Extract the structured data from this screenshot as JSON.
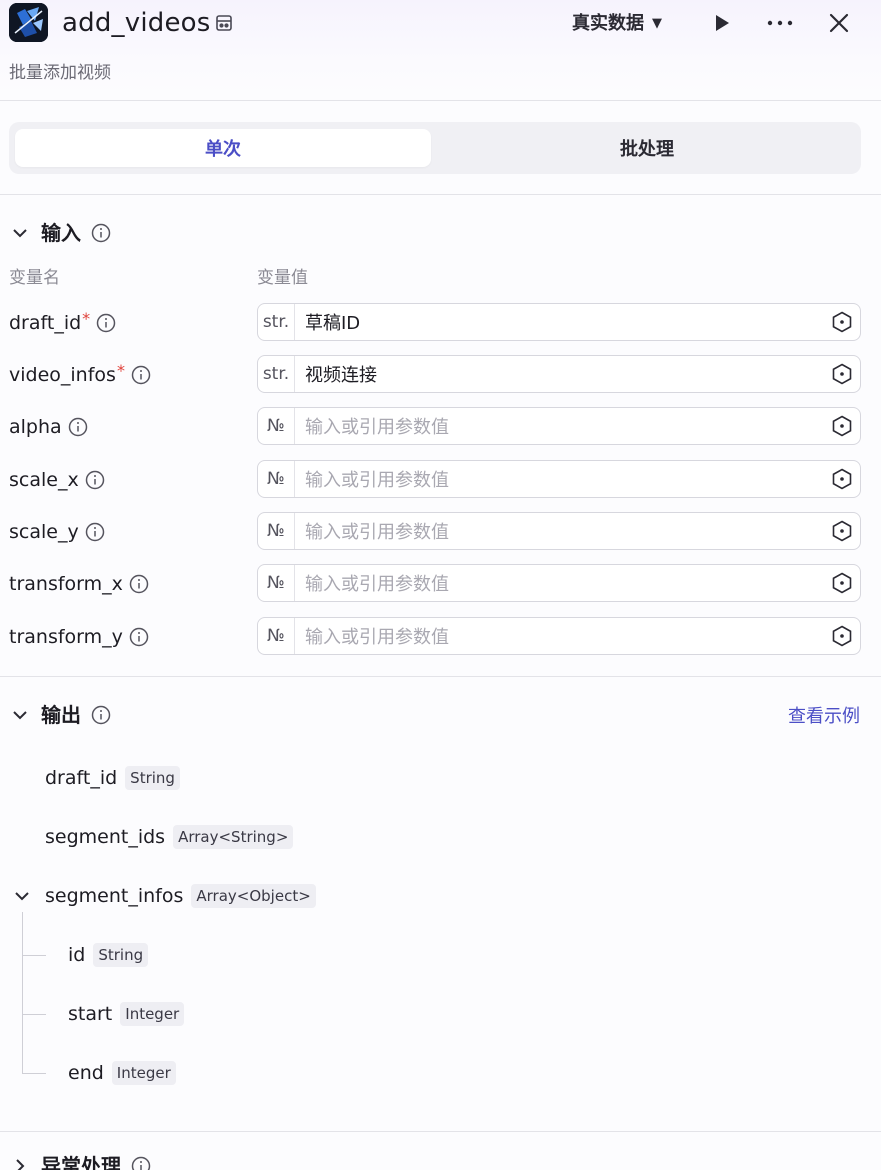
{
  "header": {
    "title": "add_videos",
    "subtitle": "批量添加视频",
    "data_mode": "真实数据"
  },
  "tabs": [
    {
      "label": "单次",
      "active": true
    },
    {
      "label": "批处理",
      "active": false
    }
  ],
  "input_section": {
    "title": "输入",
    "col_name": "变量名",
    "col_value": "变量值",
    "params": [
      {
        "name": "draft_id",
        "required": true,
        "type": "str.",
        "value": "草稿ID",
        "placeholder": ""
      },
      {
        "name": "video_infos",
        "required": true,
        "type": "str.",
        "value": "视频连接",
        "placeholder": ""
      },
      {
        "name": "alpha",
        "required": false,
        "type": "№",
        "value": "",
        "placeholder": "输入或引用参数值"
      },
      {
        "name": "scale_x",
        "required": false,
        "type": "№",
        "value": "",
        "placeholder": "输入或引用参数值"
      },
      {
        "name": "scale_y",
        "required": false,
        "type": "№",
        "value": "",
        "placeholder": "输入或引用参数值"
      },
      {
        "name": "transform_x",
        "required": false,
        "type": "№",
        "value": "",
        "placeholder": "输入或引用参数值"
      },
      {
        "name": "transform_y",
        "required": false,
        "type": "№",
        "value": "",
        "placeholder": "输入或引用参数值"
      }
    ]
  },
  "output_section": {
    "title": "输出",
    "example_link": "查看示例",
    "fields": [
      {
        "name": "draft_id",
        "type": "String"
      },
      {
        "name": "segment_ids",
        "type": "Array<String>"
      },
      {
        "name": "segment_infos",
        "type": "Array<Object>",
        "children": [
          {
            "name": "id",
            "type": "String"
          },
          {
            "name": "start",
            "type": "Integer"
          },
          {
            "name": "end",
            "type": "Integer"
          }
        ]
      }
    ]
  },
  "exception_section": {
    "title": "异常处理"
  },
  "colors": {
    "accent": "#4b4ec6",
    "required": "#e0413a"
  },
  "icons": [
    "store-icon",
    "play-icon",
    "more-icon",
    "close-icon",
    "chevron-down-icon",
    "chevron-right-icon",
    "info-icon",
    "reference-icon"
  ]
}
